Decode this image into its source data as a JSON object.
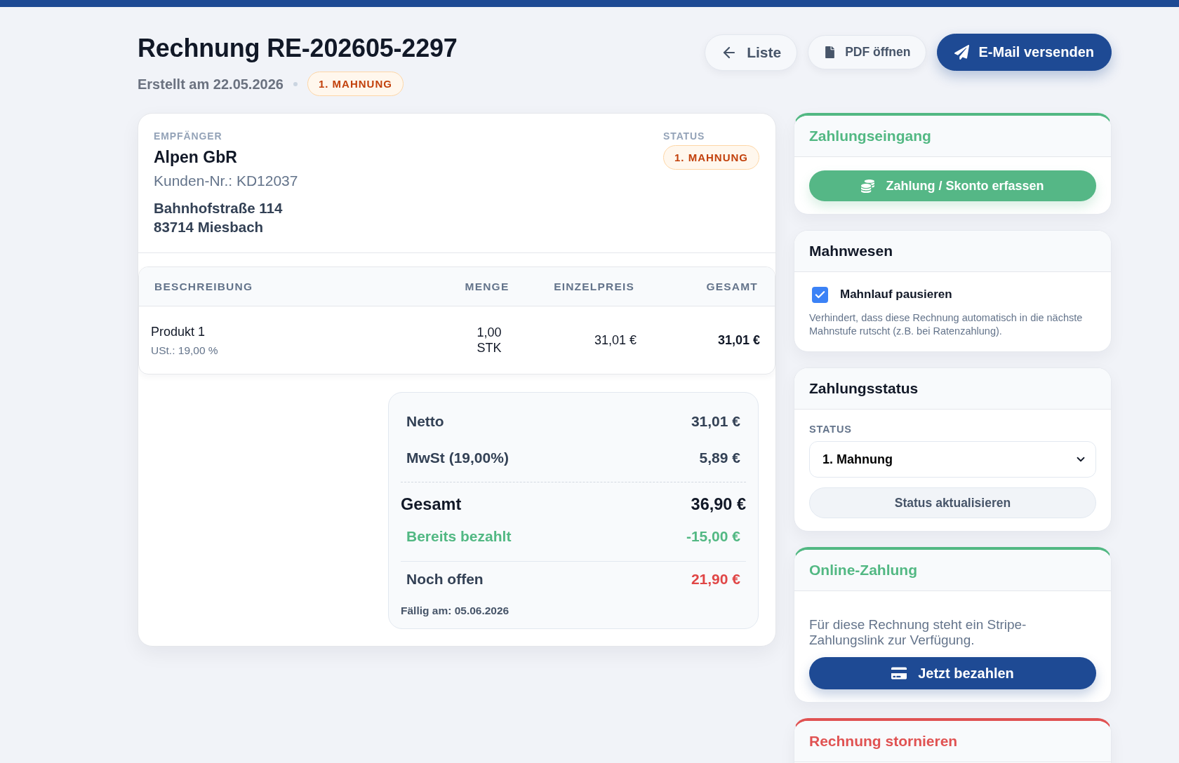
{
  "header": {
    "title": "Rechnung RE-202605-2297",
    "created": "Erstellt am 22.05.2026",
    "badge": "1. MAHNUNG",
    "actions": [
      {
        "kind": "back",
        "label": "Liste"
      },
      {
        "kind": "pdf",
        "label": "PDF öffnen"
      },
      {
        "kind": "send",
        "label": "E-Mail versenden"
      }
    ]
  },
  "invoice": {
    "recipient": {
      "label": "EMPFÄNGER",
      "name": "Alpen GbR",
      "customer_number": "Kunden-Nr.: KD12037",
      "address": [
        "Bahnhofstraße 114",
        "83714 Miesbach"
      ]
    },
    "status": {
      "label": "STATUS",
      "badge": "1. MAHNUNG"
    },
    "table": {
      "columns": [
        "BESCHREIBUNG",
        "MENGE",
        "EINZELPREIS",
        "GESAMT"
      ],
      "rows": [
        {
          "description": "Produkt 1",
          "tax": "USt.: 19,00 %",
          "quantity": "1,00",
          "unit": "STK",
          "unit_price": "31,01 €",
          "total": "31,01 €"
        }
      ]
    },
    "totals": {
      "lines": [
        {
          "kind": "subtotal",
          "label": "Netto",
          "value": "31,01 €"
        },
        {
          "kind": "subtotal",
          "label": "MwSt (19,00%)",
          "value": "5,89 €"
        },
        {
          "kind": "total",
          "label": "Gesamt",
          "value": "36,90 €"
        },
        {
          "kind": "paid",
          "label": "Bereits bezahlt",
          "value": "-15,00 €"
        },
        {
          "kind": "due",
          "label": "Noch offen",
          "value": "21,90 €"
        }
      ],
      "due_date": "Fällig am: 05.06.2026"
    }
  },
  "sidebar": {
    "cards": [
      {
        "kind": "payment_entry",
        "title": "Zahlungseingang",
        "color": "#52b883",
        "button": "Zahlung / Skonto erfassen"
      },
      {
        "kind": "dunning",
        "title": "Mahnwesen",
        "checkbox": {
          "label": "Mahnlauf pausieren",
          "checked": true
        },
        "hint": "Verhindert, dass diese Rechnung automatisch in die nächste Mahnstufe rutscht (z.B. bei Ratenzahlung)."
      },
      {
        "kind": "status",
        "title": "Zahlungsstatus",
        "field_label": "STATUS",
        "select": {
          "value": "1. Mahnung"
        },
        "button": "Status aktualisieren"
      },
      {
        "kind": "online_payment",
        "title": "Online-Zahlung",
        "color": "#52b883",
        "text": "Für diese Rechnung steht ein Stripe-Zahlungslink zur Verfügung.",
        "button": "Jetzt bezahlen"
      },
      {
        "kind": "cancel",
        "title": "Rechnung stornieren",
        "color": "#e05252"
      }
    ]
  }
}
